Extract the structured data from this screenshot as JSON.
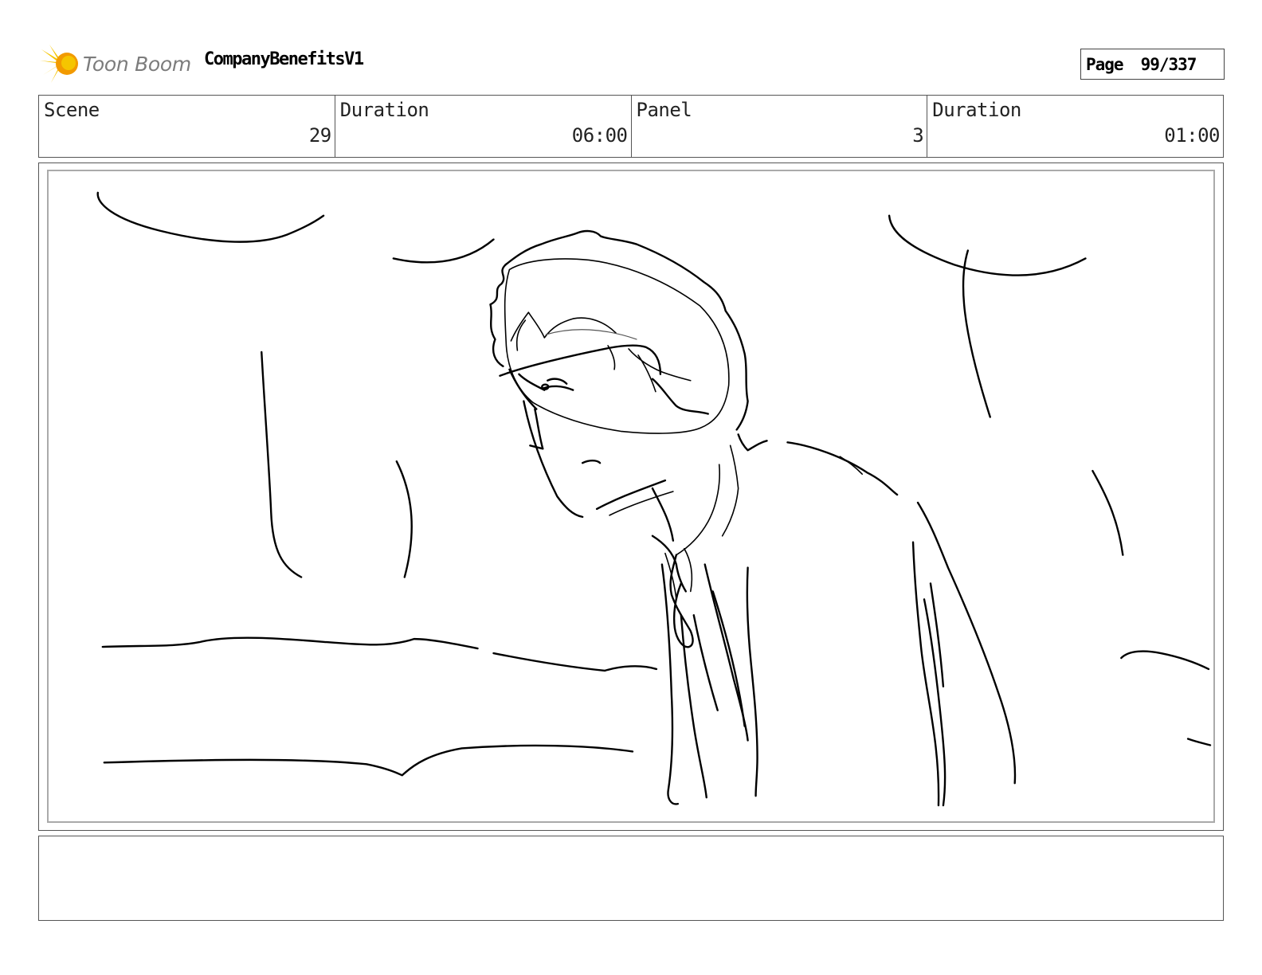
{
  "header": {
    "brand_name": "Toon Boom",
    "project_title": "CompanyBenefitsV1",
    "page_label": "Page",
    "page_number": "99/337"
  },
  "info": {
    "scene_label": "Scene",
    "scene_value": "29",
    "scene_duration_label": "Duration",
    "scene_duration_value": "06:00",
    "panel_label": "Panel",
    "panel_value": "3",
    "panel_duration_label": "Duration",
    "panel_duration_value": "01:00"
  },
  "panel": {
    "image": "pencil-sketch-person-with-glasses-icon"
  },
  "notes": {
    "text": ""
  },
  "colors": {
    "logo_yellow": "#f5c500",
    "logo_orange": "#f29a00",
    "logo_text": "#7c7c7c",
    "border": "#555555"
  }
}
